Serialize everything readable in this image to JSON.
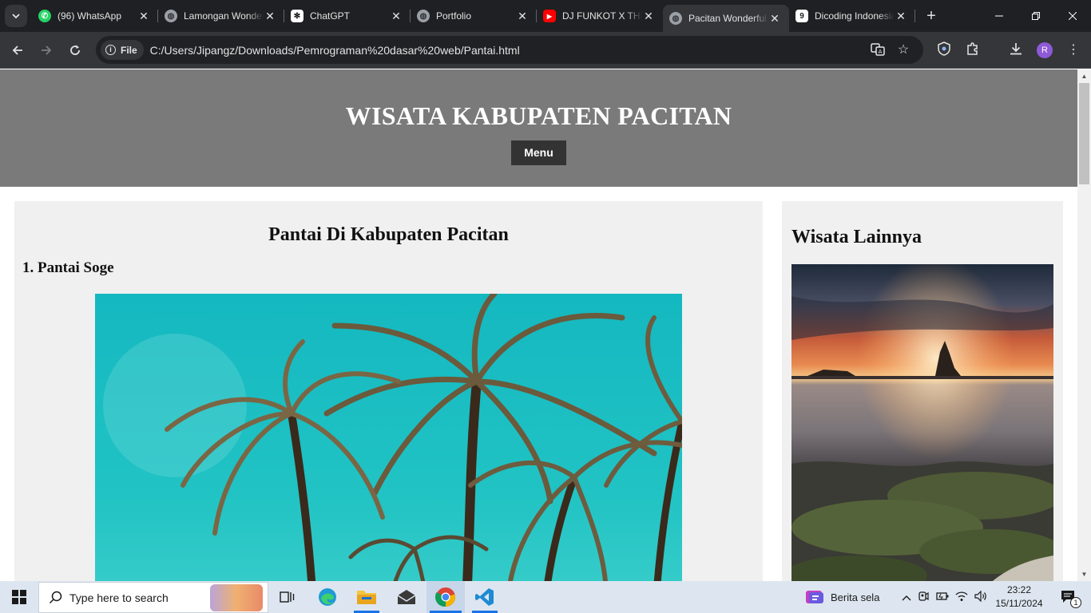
{
  "browser": {
    "tabs": [
      {
        "title": "(96) WhatsApp",
        "favicon": "whatsapp-icon",
        "color": "#25d366"
      },
      {
        "title": "Lamongan Wonderful",
        "favicon": "globe-icon",
        "color": "#9aa0a6"
      },
      {
        "title": "ChatGPT",
        "favicon": "chatgpt-icon",
        "color": "#ffffff"
      },
      {
        "title": "Portfolio",
        "favicon": "globe-icon",
        "color": "#9aa0a6"
      },
      {
        "title": "DJ FUNKOT X THE",
        "favicon": "youtube-icon",
        "color": "#ff0000"
      },
      {
        "title": "Pacitan Wonderful",
        "favicon": "globe-icon",
        "color": "#9aa0a6"
      },
      {
        "title": "Dicoding Indonesia",
        "favicon": "dicoding-icon",
        "color": "#ffffff"
      }
    ],
    "active_tab_index": 5,
    "chip_label": "File",
    "url": "C:/Users/Jipangz/Downloads/Pemrograman%20dasar%20web/Pantai.html",
    "profile_initial": "R"
  },
  "page": {
    "site_title": "WISATA KABUPATEN PACITAN",
    "menu_label": "Menu",
    "main_heading": "Pantai Di Kabupaten Pacitan",
    "item_heading": "1. Pantai Soge",
    "side_heading": "Wisata Lainnya",
    "header_color": "#7a7a7a",
    "panel_color": "#f0f0f0"
  },
  "taskbar": {
    "search_placeholder": "Type here to search",
    "news_label": "Berita sela",
    "time": "23:22",
    "date": "15/11/2024",
    "notification_count": "1"
  }
}
